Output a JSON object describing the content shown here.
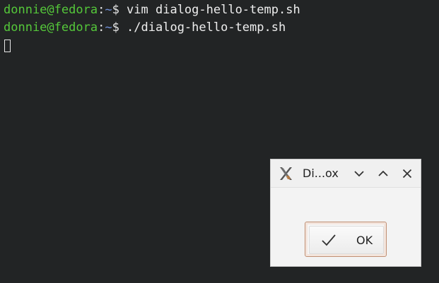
{
  "terminal": {
    "lines": [
      {
        "user_host": "donnie@fedora",
        "sep": ":",
        "path": "~",
        "prompt": "$ ",
        "command": "vim dialog-hello-temp.sh"
      },
      {
        "user_host": "donnie@fedora",
        "sep": ":",
        "path": "~",
        "prompt": "$ ",
        "command": "./dialog-hello-temp.sh"
      }
    ]
  },
  "dialog": {
    "title": "Di...ox",
    "app_icon": "x-window-app-icon",
    "controls": {
      "minimize_icon": "chevron-down-icon",
      "maximize_icon": "chevron-up-icon",
      "close_icon": "close-icon"
    },
    "ok_button": {
      "icon": "check-icon",
      "label": "OK"
    }
  },
  "colors": {
    "terminal_bg": "#222425",
    "prompt_user": "#55c83a",
    "prompt_path": "#6f8fd6",
    "text": "#e6e6e6",
    "dialog_bg": "#f3f3f3",
    "button_focus_border": "#c08f73"
  }
}
